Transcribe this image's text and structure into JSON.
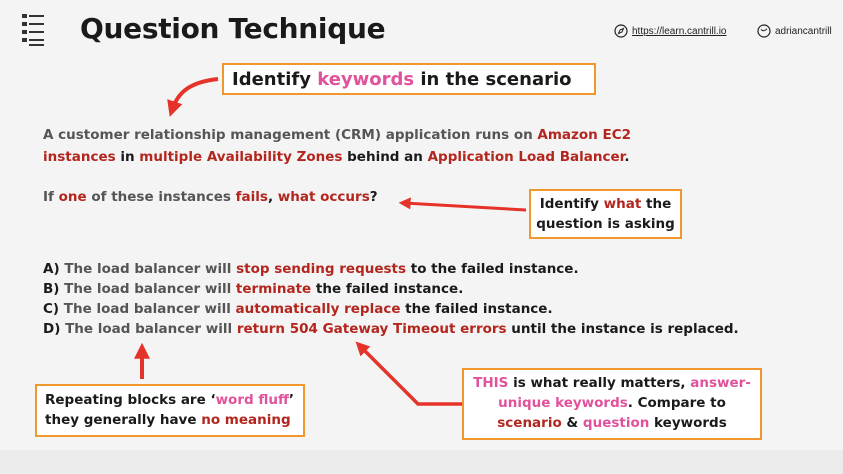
{
  "header": {
    "title": "Question Technique",
    "website": "https://learn.cantrill.io",
    "handle": "adriancantrill",
    "icons": {
      "logo": "list-menu-icon",
      "website": "compass-icon",
      "handle": "social-handle-icon"
    }
  },
  "callouts": {
    "keywords": {
      "pre": "Identify ",
      "highlight": "keywords",
      "post": " in the scenario"
    },
    "question": {
      "pre": "Identify ",
      "highlight": "what",
      "post1": " the",
      "line2": "question is asking"
    },
    "fluff": {
      "pre": "Repeating blocks are ‘",
      "highlight": "word fluff",
      "post": "’",
      "line2_pre": "they generally have ",
      "line2_highlight": "no meaning"
    },
    "matters": {
      "l1_a": "THIS",
      "l1_b": " is what really matters, ",
      "l1_c": "answer-",
      "l2_a": "unique keywords",
      "l2_b": ". Compare to",
      "l3_a": "scenario",
      "l3_b": " & ",
      "l3_c": "question",
      "l3_d": " keywords"
    }
  },
  "scenario": {
    "l1_a": "A customer relationship management (CRM) application runs on ",
    "l1_b": "Amazon EC2",
    "l2_a": "instances",
    "l2_b": " in ",
    "l2_c": "multiple Availability Zones",
    "l2_d": " behind an ",
    "l2_e": "Application Load Balancer",
    "l2_f": "."
  },
  "question": {
    "a": "If ",
    "b": "one",
    "c": " of these instances ",
    "d": "fails",
    "e": ", ",
    "f": "what occurs",
    "g": "?"
  },
  "answers": [
    {
      "letter": "A)",
      "pre": " The load balancer will ",
      "key": "stop sending requests",
      "post": " to the failed instance."
    },
    {
      "letter": "B)",
      "pre": " The load balancer will ",
      "key": "terminate",
      "post": " the failed instance."
    },
    {
      "letter": "C)",
      "pre": " The load balancer will ",
      "key": "automatically replace",
      "post": " the failed instance."
    },
    {
      "letter": "D)",
      "pre": " The load balancer will ",
      "key": "return 504 Gateway Timeout errors",
      "post": " until the instance is replaced."
    }
  ],
  "colors": {
    "red": "#b3261e",
    "pink": "#e0529c",
    "orange_border": "#f0972e",
    "arrow": "#e63329"
  }
}
